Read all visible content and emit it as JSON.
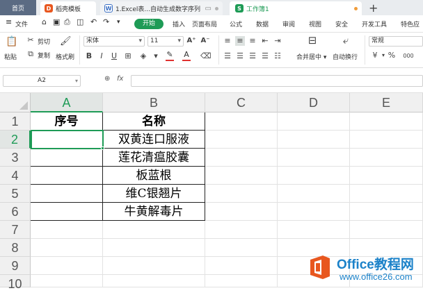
{
  "tabs": {
    "home": "首页",
    "template": "稻壳模板",
    "doc": "1.Excel表...自动生成数字序列",
    "workbook": "工作簿1"
  },
  "menu": {
    "file": "文件",
    "items": [
      "开始",
      "插入",
      "页面布局",
      "公式",
      "数据",
      "审阅",
      "视图",
      "安全",
      "开发工具",
      "特色应"
    ]
  },
  "ribbon": {
    "paste": "粘贴",
    "cut": "剪切",
    "copy": "复制",
    "format_painter": "格式刷",
    "font_name": "宋体",
    "font_size": "11",
    "merge_center": "合并居中",
    "wrap_text": "自动换行",
    "number_format": "常规",
    "currency_symbol": "¥",
    "percent_symbol": "%",
    "thousands_symbol": "000"
  },
  "formula_bar": {
    "name_box": "A2",
    "fx": "fx"
  },
  "grid": {
    "columns": [
      "A",
      "B",
      "C",
      "D",
      "E"
    ],
    "rows": [
      "1",
      "2",
      "3",
      "4",
      "5",
      "6",
      "7",
      "8",
      "9",
      "10"
    ],
    "headers": {
      "A1": "序号",
      "B1": "名称"
    },
    "names": [
      "双黄连口服液",
      "莲花清瘟胶囊",
      "板蓝根",
      "维C银翘片",
      "牛黄解毒片"
    ],
    "active_cell": "A2"
  },
  "watermark": {
    "title": "Office教程网",
    "url": "www.office26.com"
  },
  "colors": {
    "accent": "#1e9b56",
    "watermark_blue": "#1c82c9",
    "watermark_orange": "#e8571f"
  }
}
